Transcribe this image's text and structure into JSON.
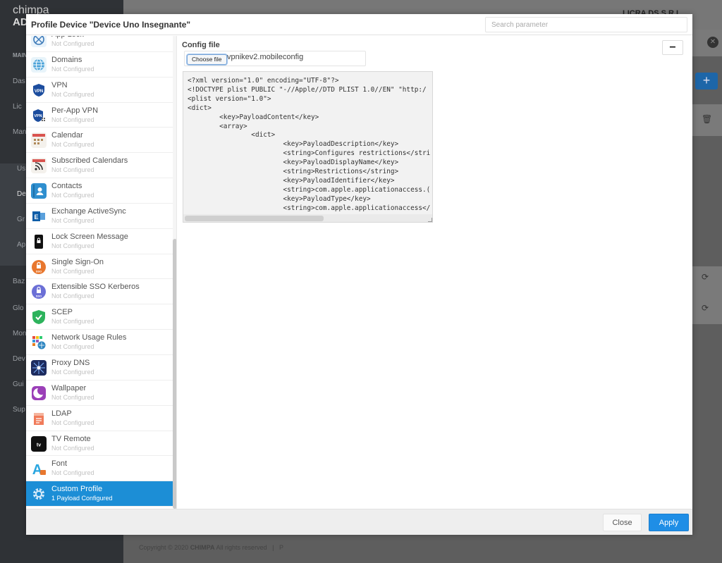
{
  "background": {
    "brand_top": "chimpa",
    "brand_bottom": "AD",
    "nav": [
      "MAIN",
      "Das",
      "Lic",
      "Man",
      "Us",
      "Dev",
      "Gr",
      "Ap",
      "Baz",
      "Glo",
      "Mon",
      "Dev",
      "Gui",
      "Sup"
    ],
    "company": "LICRA DS S.R.L.",
    "plus": "+",
    "close_x": "✕",
    "trash": "🗑",
    "refresh": "⟳",
    "footer_copyright": "Copyright © 2020",
    "footer_brand": "CHIMPA",
    "footer_rights": "All rights reserved",
    "footer_sep": "|",
    "footer_more": "P"
  },
  "modal": {
    "title": "Profile Device \"Device Uno Insegnante\"",
    "search_placeholder": "Search parameter"
  },
  "payloads": [
    {
      "name": "App Lock",
      "status": "Not Configured",
      "icon": "app-lock-icon"
    },
    {
      "name": "Domains",
      "status": "Not Configured",
      "icon": "domains-icon"
    },
    {
      "name": "VPN",
      "status": "Not Configured",
      "icon": "vpn-icon"
    },
    {
      "name": "Per-App VPN",
      "status": "Not Configured",
      "icon": "per-app-vpn-icon"
    },
    {
      "name": "Calendar",
      "status": "Not Configured",
      "icon": "calendar-icon"
    },
    {
      "name": "Subscribed Calendars",
      "status": "Not Configured",
      "icon": "subscribed-calendars-icon"
    },
    {
      "name": "Contacts",
      "status": "Not Configured",
      "icon": "contacts-icon"
    },
    {
      "name": "Exchange ActiveSync",
      "status": "Not Configured",
      "icon": "exchange-icon"
    },
    {
      "name": "Lock Screen Message",
      "status": "Not Configured",
      "icon": "lock-screen-icon"
    },
    {
      "name": "Single Sign-On",
      "status": "Not Configured",
      "icon": "sso-icon"
    },
    {
      "name": "Extensible SSO Kerberos",
      "status": "Not Configured",
      "icon": "sso-kerberos-icon"
    },
    {
      "name": "SCEP",
      "status": "Not Configured",
      "icon": "scep-shield-icon"
    },
    {
      "name": "Network Usage Rules",
      "status": "Not Configured",
      "icon": "network-usage-icon"
    },
    {
      "name": "Proxy DNS",
      "status": "Not Configured",
      "icon": "proxy-dns-icon"
    },
    {
      "name": "Wallpaper",
      "status": "Not Configured",
      "icon": "wallpaper-icon"
    },
    {
      "name": "LDAP",
      "status": "Not Configured",
      "icon": "ldap-icon"
    },
    {
      "name": "TV Remote",
      "status": "Not Configured",
      "icon": "tv-remote-icon"
    },
    {
      "name": "Font",
      "status": "Not Configured",
      "icon": "font-icon"
    },
    {
      "name": "Custom Profile",
      "status": "1 Payload Configured",
      "icon": "custom-profile-gear-icon",
      "active": true
    }
  ],
  "content": {
    "section_label": "Config file",
    "choose_file_label": "Choose file",
    "file_name": "vpnikev2.mobileconfig",
    "remove_label": "−",
    "code": "<?xml version=\"1.0\" encoding=\"UTF-8\"?>\n<!DOCTYPE plist PUBLIC \"-//Apple//DTD PLIST 1.0//EN\" \"http:/\n<plist version=\"1.0\">\n<dict>\n        <key>PayloadContent</key>\n        <array>\n                <dict>\n                        <key>PayloadDescription</key>\n                        <string>Configures restrictions</stri\n                        <key>PayloadDisplayName</key>\n                        <string>Restrictions</string>\n                        <key>PayloadIdentifier</key>\n                        <string>com.apple.applicationaccess.(\n                        <key>PayloadType</key>\n                        <string>com.apple.applicationaccess</"
  },
  "footer": {
    "close_label": "Close",
    "apply_label": "Apply"
  },
  "colors": {
    "accent": "#1f8ee6",
    "active_item": "#1c8ed6",
    "overlay_dark": "#2f3236"
  }
}
